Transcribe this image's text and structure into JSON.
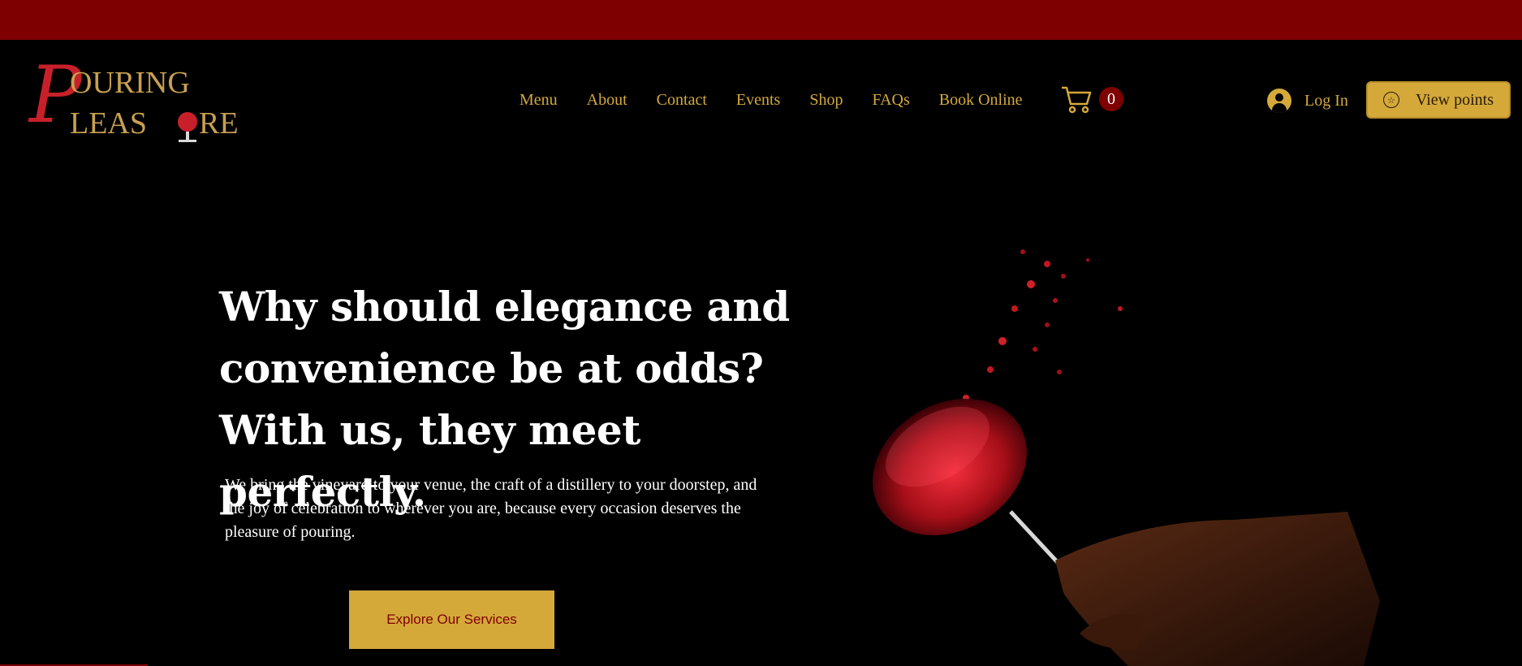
{
  "brand": {
    "logo_name": "Pouring Pleasure logo",
    "colors": {
      "accent": "#d4a93a",
      "brand_red": "#7f0000",
      "background": "#000000"
    }
  },
  "nav": {
    "items": [
      {
        "label": "Menu"
      },
      {
        "label": "About"
      },
      {
        "label": "Contact"
      },
      {
        "label": "Events"
      },
      {
        "label": "Shop"
      },
      {
        "label": "FAQs"
      },
      {
        "label": "Book Online"
      }
    ]
  },
  "cart": {
    "icon": "cart-icon",
    "count": "0"
  },
  "account": {
    "login_label": "Log In",
    "avatar_icon": "user-icon"
  },
  "points": {
    "label": "View points",
    "icon": "star-circle-icon"
  },
  "hero": {
    "headline": "Why should elegance and convenience be at odds? With us, they meet perfectly.",
    "subtext": "We bring the vineyard to your venue, the craft of a distillery to your doorstep, and the joy of celebration to wherever you are, because every occasion deserves the pleasure of pouring.",
    "cta_label": "Explore Our Services",
    "image": "hand-holding-splashing-wine-glass"
  }
}
